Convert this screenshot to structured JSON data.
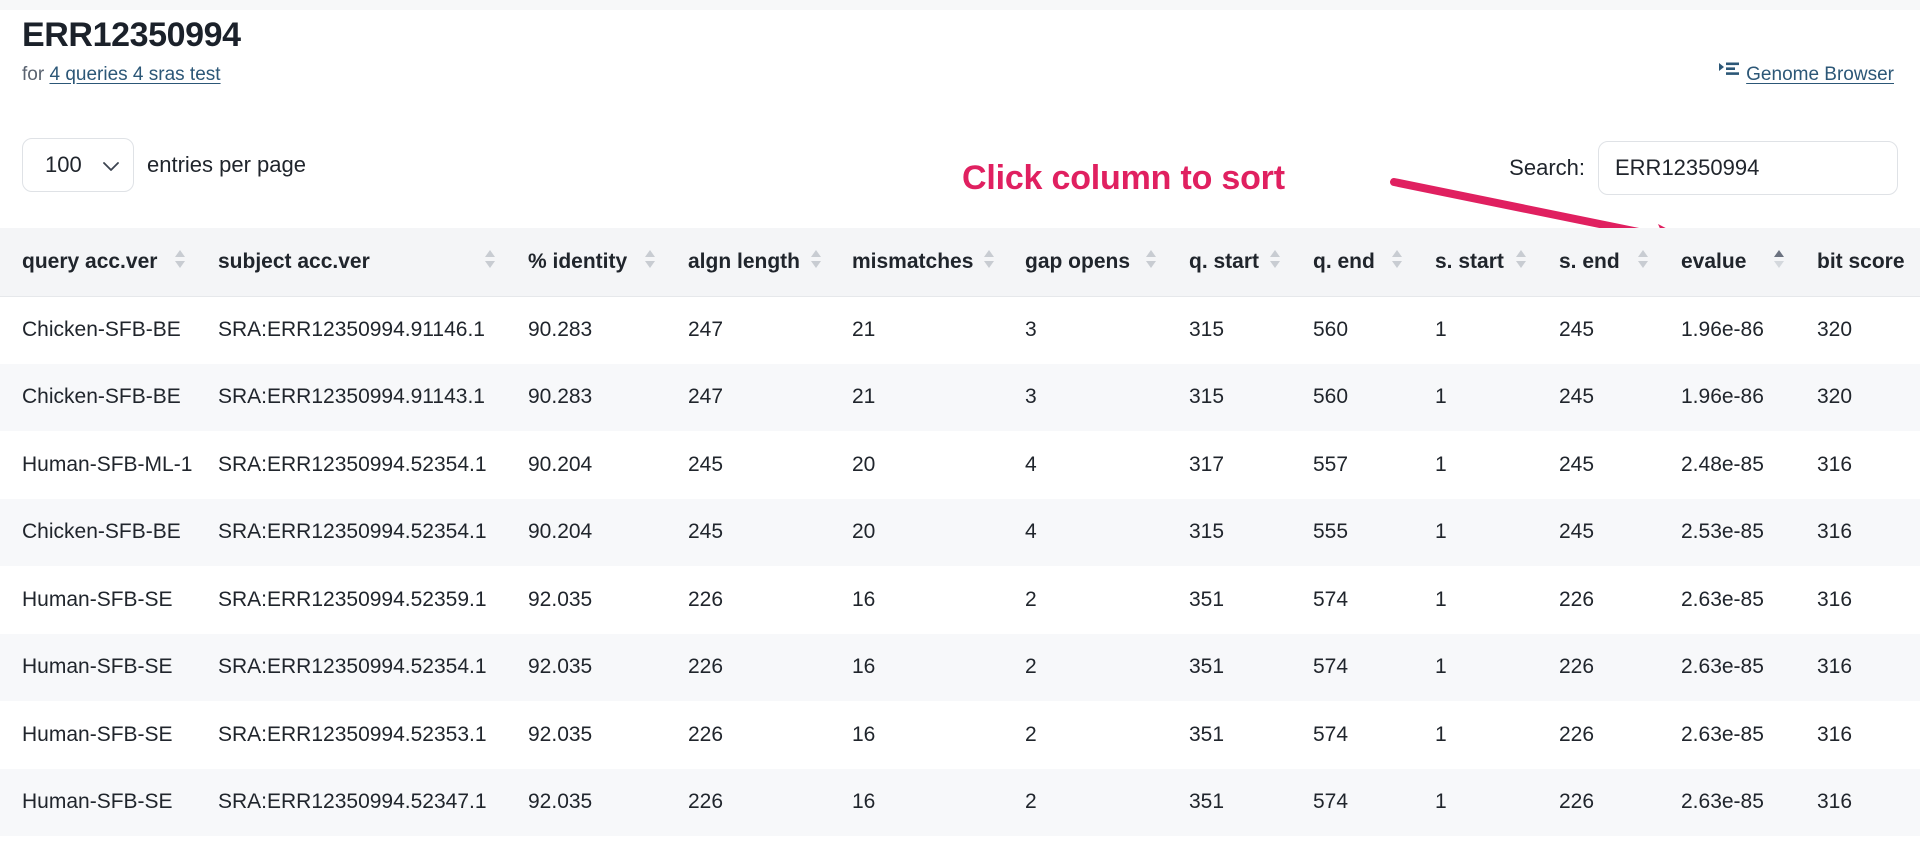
{
  "header": {
    "title": "ERR12350994",
    "for_label": "for",
    "dataset_link": "4 queries 4 sras test",
    "genome_browser_link": "Genome Browser",
    "genome_browser_icon": "list-view-icon"
  },
  "controls": {
    "entries_value": "100",
    "entries_options": [
      "100"
    ],
    "entries_label": "entries per page",
    "entries_chevron_icon": "chevron-down-icon",
    "search_label": "Search:",
    "search_value": "ERR12350994",
    "search_placeholder": ""
  },
  "annotation": {
    "text": "Click column to sort",
    "color": "#e02060",
    "arrow_icon": "arrow-pointer-icon",
    "points_to": "evalue"
  },
  "table": {
    "sorted_column": "evalue",
    "sort_direction": "asc",
    "columns": [
      "query acc.ver",
      "subject acc.ver",
      "% identity",
      "algn length",
      "mismatches",
      "gap opens",
      "q. start",
      "q. end",
      "s. start",
      "s. end",
      "evalue",
      "bit score"
    ],
    "rows": [
      [
        "Chicken-SFB-BE",
        "SRA:ERR12350994.91146.1",
        "90.283",
        "247",
        "21",
        "3",
        "315",
        "560",
        "1",
        "245",
        "1.96e-86",
        "320"
      ],
      [
        "Chicken-SFB-BE",
        "SRA:ERR12350994.91143.1",
        "90.283",
        "247",
        "21",
        "3",
        "315",
        "560",
        "1",
        "245",
        "1.96e-86",
        "320"
      ],
      [
        "Human-SFB-ML-1",
        "SRA:ERR12350994.52354.1",
        "90.204",
        "245",
        "20",
        "4",
        "317",
        "557",
        "1",
        "245",
        "2.48e-85",
        "316"
      ],
      [
        "Chicken-SFB-BE",
        "SRA:ERR12350994.52354.1",
        "90.204",
        "245",
        "20",
        "4",
        "315",
        "555",
        "1",
        "245",
        "2.53e-85",
        "316"
      ],
      [
        "Human-SFB-SE",
        "SRA:ERR12350994.52359.1",
        "92.035",
        "226",
        "16",
        "2",
        "351",
        "574",
        "1",
        "226",
        "2.63e-85",
        "316"
      ],
      [
        "Human-SFB-SE",
        "SRA:ERR12350994.52354.1",
        "92.035",
        "226",
        "16",
        "2",
        "351",
        "574",
        "1",
        "226",
        "2.63e-85",
        "316"
      ],
      [
        "Human-SFB-SE",
        "SRA:ERR12350994.52353.1",
        "92.035",
        "226",
        "16",
        "2",
        "351",
        "574",
        "1",
        "226",
        "2.63e-85",
        "316"
      ],
      [
        "Human-SFB-SE",
        "SRA:ERR12350994.52347.1",
        "92.035",
        "226",
        "16",
        "2",
        "351",
        "574",
        "1",
        "226",
        "2.63e-85",
        "316"
      ]
    ]
  }
}
